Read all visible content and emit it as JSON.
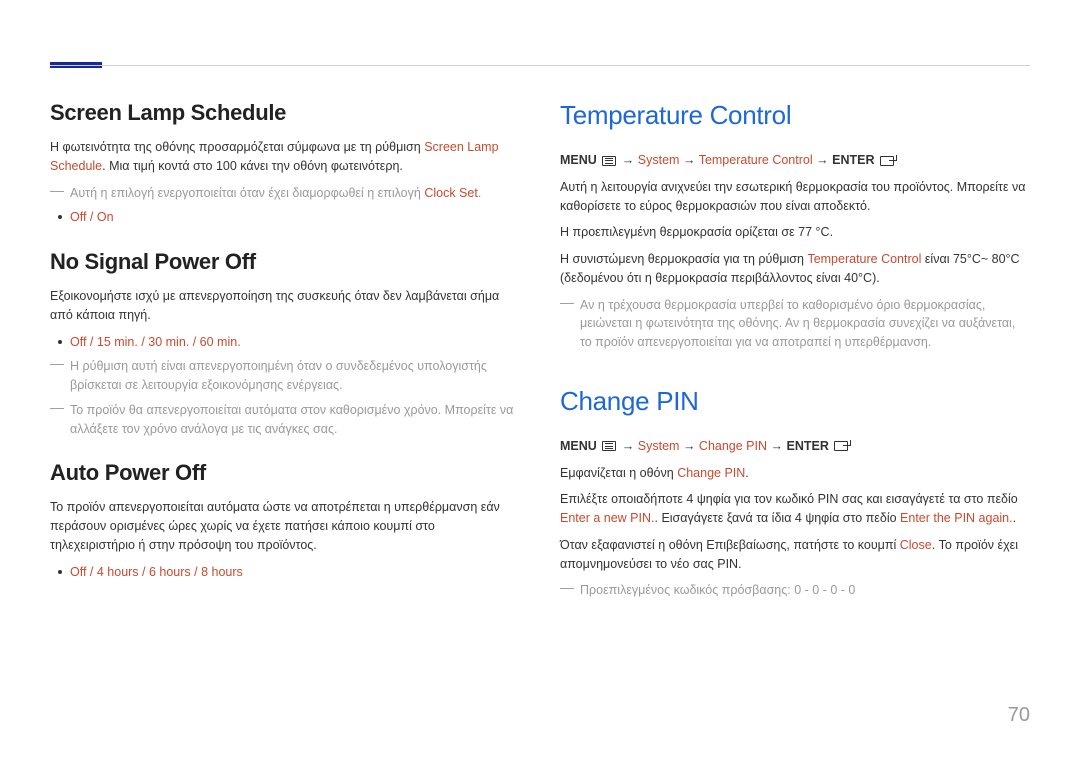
{
  "pageNumber": "70",
  "left": {
    "section1": {
      "heading": "Screen Lamp Schedule",
      "para1a": "Η φωτεινότητα της οθόνης προσαρμόζεται σύμφωνα με τη ρύθμιση ",
      "para1red": "Screen Lamp Schedule",
      "para1b": ". Μια τιμή κοντά στο 100 κάνει την οθόνη φωτεινότερη.",
      "note1a": "Αυτή η επιλογή ενεργοποιείται όταν έχει διαμορφωθεί η επιλογή ",
      "note1red": "Clock Set",
      "note1b": ".",
      "bullet1": "Off / On"
    },
    "section2": {
      "heading": "No Signal Power Off",
      "para1": "Εξοικονομήστε ισχύ με απενεργοποίηση της συσκευής όταν δεν λαμβάνεται σήμα από κάποια πηγή.",
      "bullet1": "Off / 15 min. / 30 min. / 60 min.",
      "note1": "Η ρύθμιση αυτή είναι απενεργοποιημένη όταν ο συνδεδεμένος υπολογιστής βρίσκεται σε λειτουργία εξοικονόμησης ενέργειας.",
      "note2": "Το προϊόν θα απενεργοποιείται αυτόματα στον καθορισμένο χρόνο. Μπορείτε να αλλάξετε τον χρόνο ανάλογα με τις ανάγκες σας."
    },
    "section3": {
      "heading": "Auto Power Off",
      "para1": "Το προϊόν απενεργοποιείται αυτόματα ώστε να αποτρέπεται η υπερθέρμανση εάν περάσουν ορισμένες ώρες χωρίς να έχετε πατήσει κάποιο κουμπί στο τηλεχειριστήριο ή στην πρόσοψη του προϊόντος.",
      "bullet1": "Off / 4 hours / 6 hours / 8 hours"
    }
  },
  "right": {
    "section1": {
      "heading": "Temperature Control",
      "nav": {
        "menu": "MENU",
        "arrow": " → ",
        "sys": "System",
        "tc": "Temperature Control",
        "enter": "ENTER"
      },
      "para1": "Αυτή η λειτουργία ανιχνεύει την εσωτερική θερμοκρασία του προϊόντος. Μπορείτε να καθορίσετε το εύρος θερμοκρασιών που είναι αποδεκτό.",
      "para2": "Η προεπιλεγμένη θερμοκρασία ορίζεται σε 77 °C.",
      "para3a": "Η συνιστώμενη θερμοκρασία για τη ρύθμιση ",
      "para3red": "Temperature Control",
      "para3b": " είναι 75°C~ 80°C (δεδομένου ότι η θερμοκρασία περιβάλλοντος είναι 40°C).",
      "note1": "Αν η τρέχουσα θερμοκρασία υπερβεί το καθορισμένο όριο θερμοκρασίας, μειώνεται η φωτεινότητα της οθόνης. Αν η θερμοκρασία συνεχίζει να αυξάνεται, το προϊόν απενεργοποιείται για να αποτραπεί η υπερθέρμανση."
    },
    "section2": {
      "heading": "Change PIN",
      "nav": {
        "menu": "MENU",
        "arrow": " → ",
        "sys": "System",
        "cp": "Change PIN",
        "enter": "ENTER"
      },
      "para1a": "Εμφανίζεται η οθόνη ",
      "para1red": "Change PIN",
      "para1b": ".",
      "para2a": "Επιλέξτε οποιαδήποτε 4 ψηφία για τον κωδικό PIN σας και εισαγάγετέ τα στο πεδίο ",
      "para2red1": "Enter a new PIN.",
      "para2b": ". Εισαγάγετε ξανά τα ίδια 4 ψηφία στο πεδίο ",
      "para2red2": "Enter the PIN again.",
      "para2c": ".",
      "para3a": "Όταν εξαφανιστεί η οθόνη Επιβεβαίωσης, πατήστε το κουμπί ",
      "para3red": "Close",
      "para3b": ". Το προϊόν έχει απομνημονεύσει το νέο σας PIN.",
      "note1": "Προεπιλεγμένος κωδικός πρόσβασης: 0 - 0 - 0 - 0"
    }
  }
}
